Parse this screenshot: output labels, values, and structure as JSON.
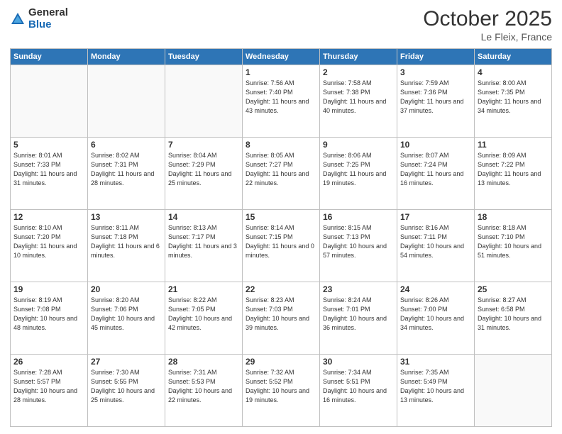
{
  "header": {
    "logo_general": "General",
    "logo_blue": "Blue",
    "month": "October 2025",
    "location": "Le Fleix, France"
  },
  "weekdays": [
    "Sunday",
    "Monday",
    "Tuesday",
    "Wednesday",
    "Thursday",
    "Friday",
    "Saturday"
  ],
  "weeks": [
    [
      {
        "day": "",
        "info": ""
      },
      {
        "day": "",
        "info": ""
      },
      {
        "day": "",
        "info": ""
      },
      {
        "day": "1",
        "info": "Sunrise: 7:56 AM\nSunset: 7:40 PM\nDaylight: 11 hours\nand 43 minutes."
      },
      {
        "day": "2",
        "info": "Sunrise: 7:58 AM\nSunset: 7:38 PM\nDaylight: 11 hours\nand 40 minutes."
      },
      {
        "day": "3",
        "info": "Sunrise: 7:59 AM\nSunset: 7:36 PM\nDaylight: 11 hours\nand 37 minutes."
      },
      {
        "day": "4",
        "info": "Sunrise: 8:00 AM\nSunset: 7:35 PM\nDaylight: 11 hours\nand 34 minutes."
      }
    ],
    [
      {
        "day": "5",
        "info": "Sunrise: 8:01 AM\nSunset: 7:33 PM\nDaylight: 11 hours\nand 31 minutes."
      },
      {
        "day": "6",
        "info": "Sunrise: 8:02 AM\nSunset: 7:31 PM\nDaylight: 11 hours\nand 28 minutes."
      },
      {
        "day": "7",
        "info": "Sunrise: 8:04 AM\nSunset: 7:29 PM\nDaylight: 11 hours\nand 25 minutes."
      },
      {
        "day": "8",
        "info": "Sunrise: 8:05 AM\nSunset: 7:27 PM\nDaylight: 11 hours\nand 22 minutes."
      },
      {
        "day": "9",
        "info": "Sunrise: 8:06 AM\nSunset: 7:25 PM\nDaylight: 11 hours\nand 19 minutes."
      },
      {
        "day": "10",
        "info": "Sunrise: 8:07 AM\nSunset: 7:24 PM\nDaylight: 11 hours\nand 16 minutes."
      },
      {
        "day": "11",
        "info": "Sunrise: 8:09 AM\nSunset: 7:22 PM\nDaylight: 11 hours\nand 13 minutes."
      }
    ],
    [
      {
        "day": "12",
        "info": "Sunrise: 8:10 AM\nSunset: 7:20 PM\nDaylight: 11 hours\nand 10 minutes."
      },
      {
        "day": "13",
        "info": "Sunrise: 8:11 AM\nSunset: 7:18 PM\nDaylight: 11 hours\nand 6 minutes."
      },
      {
        "day": "14",
        "info": "Sunrise: 8:13 AM\nSunset: 7:17 PM\nDaylight: 11 hours\nand 3 minutes."
      },
      {
        "day": "15",
        "info": "Sunrise: 8:14 AM\nSunset: 7:15 PM\nDaylight: 11 hours\nand 0 minutes."
      },
      {
        "day": "16",
        "info": "Sunrise: 8:15 AM\nSunset: 7:13 PM\nDaylight: 10 hours\nand 57 minutes."
      },
      {
        "day": "17",
        "info": "Sunrise: 8:16 AM\nSunset: 7:11 PM\nDaylight: 10 hours\nand 54 minutes."
      },
      {
        "day": "18",
        "info": "Sunrise: 8:18 AM\nSunset: 7:10 PM\nDaylight: 10 hours\nand 51 minutes."
      }
    ],
    [
      {
        "day": "19",
        "info": "Sunrise: 8:19 AM\nSunset: 7:08 PM\nDaylight: 10 hours\nand 48 minutes."
      },
      {
        "day": "20",
        "info": "Sunrise: 8:20 AM\nSunset: 7:06 PM\nDaylight: 10 hours\nand 45 minutes."
      },
      {
        "day": "21",
        "info": "Sunrise: 8:22 AM\nSunset: 7:05 PM\nDaylight: 10 hours\nand 42 minutes."
      },
      {
        "day": "22",
        "info": "Sunrise: 8:23 AM\nSunset: 7:03 PM\nDaylight: 10 hours\nand 39 minutes."
      },
      {
        "day": "23",
        "info": "Sunrise: 8:24 AM\nSunset: 7:01 PM\nDaylight: 10 hours\nand 36 minutes."
      },
      {
        "day": "24",
        "info": "Sunrise: 8:26 AM\nSunset: 7:00 PM\nDaylight: 10 hours\nand 34 minutes."
      },
      {
        "day": "25",
        "info": "Sunrise: 8:27 AM\nSunset: 6:58 PM\nDaylight: 10 hours\nand 31 minutes."
      }
    ],
    [
      {
        "day": "26",
        "info": "Sunrise: 7:28 AM\nSunset: 5:57 PM\nDaylight: 10 hours\nand 28 minutes."
      },
      {
        "day": "27",
        "info": "Sunrise: 7:30 AM\nSunset: 5:55 PM\nDaylight: 10 hours\nand 25 minutes."
      },
      {
        "day": "28",
        "info": "Sunrise: 7:31 AM\nSunset: 5:53 PM\nDaylight: 10 hours\nand 22 minutes."
      },
      {
        "day": "29",
        "info": "Sunrise: 7:32 AM\nSunset: 5:52 PM\nDaylight: 10 hours\nand 19 minutes."
      },
      {
        "day": "30",
        "info": "Sunrise: 7:34 AM\nSunset: 5:51 PM\nDaylight: 10 hours\nand 16 minutes."
      },
      {
        "day": "31",
        "info": "Sunrise: 7:35 AM\nSunset: 5:49 PM\nDaylight: 10 hours\nand 13 minutes."
      },
      {
        "day": "",
        "info": ""
      }
    ]
  ]
}
